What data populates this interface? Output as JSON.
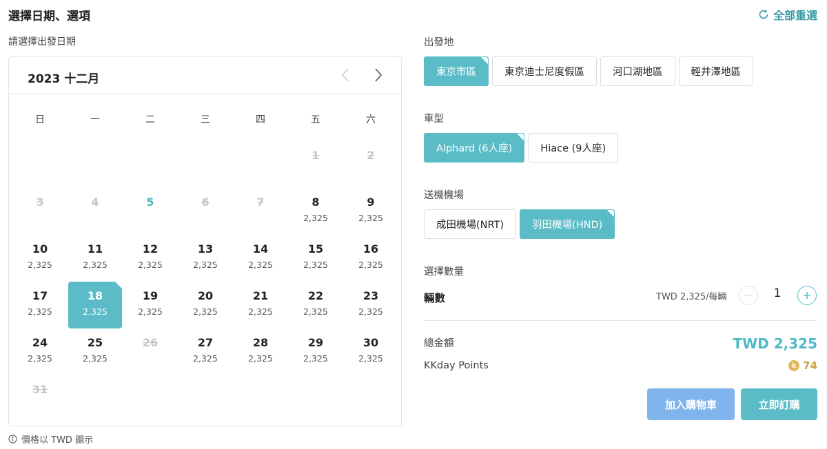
{
  "header": {
    "title": "選擇日期、選項",
    "reset_label": "全部重選",
    "date_prompt": "請選擇出發日期"
  },
  "calendar": {
    "month_label": "2023 十二月",
    "weekdays": [
      "日",
      "一",
      "二",
      "三",
      "四",
      "五",
      "六"
    ],
    "leading_blanks": 5,
    "days": [
      {
        "d": "1",
        "price": "",
        "state": "disabled"
      },
      {
        "d": "2",
        "price": "",
        "state": "disabled"
      },
      {
        "d": "3",
        "price": "",
        "state": "disabled"
      },
      {
        "d": "4",
        "price": "",
        "state": "disabled"
      },
      {
        "d": "5",
        "price": "",
        "state": "today"
      },
      {
        "d": "6",
        "price": "",
        "state": "disabled"
      },
      {
        "d": "7",
        "price": "",
        "state": "disabled"
      },
      {
        "d": "8",
        "price": "2,325",
        "state": "available"
      },
      {
        "d": "9",
        "price": "2,325",
        "state": "available"
      },
      {
        "d": "10",
        "price": "2,325",
        "state": "available"
      },
      {
        "d": "11",
        "price": "2,325",
        "state": "available"
      },
      {
        "d": "12",
        "price": "2,325",
        "state": "available"
      },
      {
        "d": "13",
        "price": "2,325",
        "state": "available"
      },
      {
        "d": "14",
        "price": "2,325",
        "state": "available"
      },
      {
        "d": "15",
        "price": "2,325",
        "state": "available"
      },
      {
        "d": "16",
        "price": "2,325",
        "state": "available"
      },
      {
        "d": "17",
        "price": "2,325",
        "state": "available"
      },
      {
        "d": "18",
        "price": "2,325",
        "state": "selected"
      },
      {
        "d": "19",
        "price": "2,325",
        "state": "available"
      },
      {
        "d": "20",
        "price": "2,325",
        "state": "available"
      },
      {
        "d": "21",
        "price": "2,325",
        "state": "available"
      },
      {
        "d": "22",
        "price": "2,325",
        "state": "available"
      },
      {
        "d": "23",
        "price": "2,325",
        "state": "available"
      },
      {
        "d": "24",
        "price": "2,325",
        "state": "available"
      },
      {
        "d": "25",
        "price": "2,325",
        "state": "available"
      },
      {
        "d": "26",
        "price": "",
        "state": "disabled"
      },
      {
        "d": "27",
        "price": "2,325",
        "state": "available"
      },
      {
        "d": "28",
        "price": "2,325",
        "state": "available"
      },
      {
        "d": "29",
        "price": "2,325",
        "state": "available"
      },
      {
        "d": "30",
        "price": "2,325",
        "state": "available"
      },
      {
        "d": "31",
        "price": "",
        "state": "disabled"
      }
    ],
    "currency_note": "價格以 TWD 顯示"
  },
  "departure": {
    "label": "出發地",
    "options": [
      {
        "label": "東京市區",
        "selected": true
      },
      {
        "label": "東京迪士尼度假區",
        "selected": false
      },
      {
        "label": "河口湖地區",
        "selected": false
      },
      {
        "label": "輕井澤地區",
        "selected": false
      }
    ]
  },
  "vehicle": {
    "label": "車型",
    "options": [
      {
        "label": "Alphard (6人座)",
        "selected": true
      },
      {
        "label": "Hiace (9人座)",
        "selected": false
      }
    ]
  },
  "airport": {
    "label": "送機機場",
    "options": [
      {
        "label": "成田機場(NRT)",
        "selected": false
      },
      {
        "label": "羽田機場(HND)",
        "selected": true
      }
    ]
  },
  "quantity": {
    "section_label": "選擇數量",
    "item_label": "輛數",
    "unit_price": "TWD 2,325/每輛",
    "value": "1"
  },
  "summary": {
    "total_label": "總金額",
    "total_value": "TWD 2,325",
    "points_label": "KKday Points",
    "points_value": "74",
    "coin_glyph": "k"
  },
  "actions": {
    "add_to_cart": "加入購物車",
    "buy_now": "立即訂購"
  },
  "colors": {
    "accent": "#5bbcc7",
    "cart_button": "#7fb4ec",
    "points": "#c9a248"
  }
}
